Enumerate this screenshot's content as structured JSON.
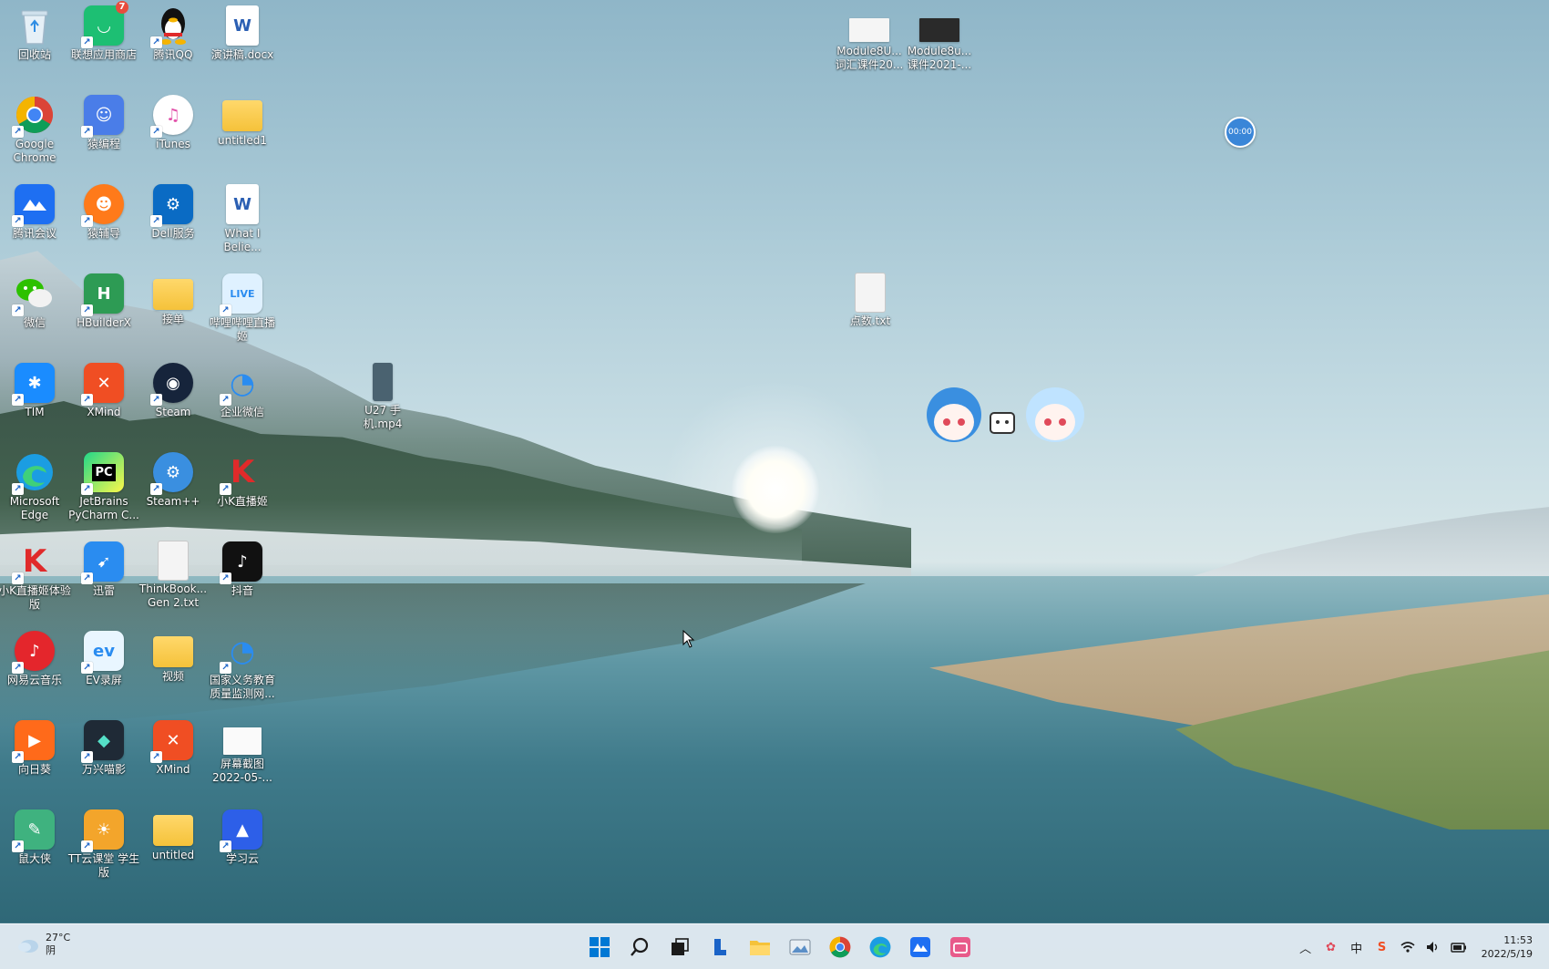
{
  "desktop": {
    "icons": [
      {
        "label": "回收站"
      },
      {
        "label": "联想应用商店",
        "badge": "7"
      },
      {
        "label": "腾讯QQ"
      },
      {
        "label": "演讲稿.docx"
      },
      {
        "label": "Google Chrome"
      },
      {
        "label": "猿编程"
      },
      {
        "label": "iTunes"
      },
      {
        "label": "untitled1"
      },
      {
        "label": "腾讯会议"
      },
      {
        "label": "猿辅导"
      },
      {
        "label": "Dell服务"
      },
      {
        "label": "What I Belie..."
      },
      {
        "label": "微信"
      },
      {
        "label": "HBuilderX"
      },
      {
        "label": "接单"
      },
      {
        "label": "哔哩哔哩直播姬"
      },
      {
        "label": "TIM"
      },
      {
        "label": "XMind"
      },
      {
        "label": "Steam"
      },
      {
        "label": "企业微信"
      },
      {
        "label": "Microsoft Edge"
      },
      {
        "label": "JetBrains PyCharm C..."
      },
      {
        "label": "Steam++"
      },
      {
        "label": "小K直播姬"
      },
      {
        "label": "小K直播姬体验版"
      },
      {
        "label": "迅雷"
      },
      {
        "label": "ThinkBook... Gen 2.txt"
      },
      {
        "label": "抖音"
      },
      {
        "label": "网易云音乐"
      },
      {
        "label": "EV录屏"
      },
      {
        "label": "视频"
      },
      {
        "label": "国家义务教育质量监测网..."
      },
      {
        "label": "向日葵"
      },
      {
        "label": "万兴喵影"
      },
      {
        "label": "XMind"
      },
      {
        "label": "屏幕截图 2022-05-..."
      },
      {
        "label": "鼠大侠"
      },
      {
        "label": "TT云课堂 学生版"
      },
      {
        "label": "untitled"
      },
      {
        "label": "学习云"
      },
      {
        "label": "U27 手机.mp4"
      },
      {
        "label": "Module8U... 词汇课件20..."
      },
      {
        "label": "Module8u... 课件2021-..."
      },
      {
        "label": "点数.txt"
      }
    ]
  },
  "widgets": {
    "timer": "00:00"
  },
  "taskbar": {
    "weather_temp": "27°C",
    "weather_desc": "阴",
    "apps": [
      {
        "name": "start"
      },
      {
        "name": "search"
      },
      {
        "name": "task-view"
      },
      {
        "name": "lenovo"
      },
      {
        "name": "file-explorer"
      },
      {
        "name": "photos"
      },
      {
        "name": "chrome"
      },
      {
        "name": "edge"
      },
      {
        "name": "tencent-meeting"
      },
      {
        "name": "bilibili-live"
      }
    ],
    "tray": {
      "ime": "中",
      "time": "11:53",
      "date": "2022/5/19"
    }
  },
  "colors": {
    "accent": "#0067c0",
    "taskbar_bg": "#e8f0f6",
    "badge": "#e84c3d"
  }
}
